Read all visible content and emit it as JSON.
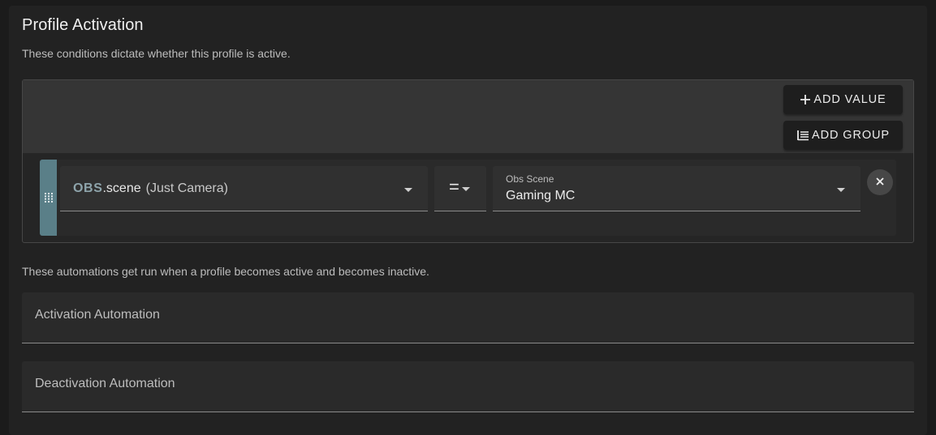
{
  "profile_activation": {
    "title": "Profile Activation",
    "description": "These conditions dictate whether this profile is active.",
    "buttons": {
      "add_value": "ADD VALUE",
      "add_group": "ADD GROUP"
    },
    "condition": {
      "variable_prefix": "OBS",
      "variable_name": ".scene",
      "variable_detail": "(Just Camera)",
      "operator": "=",
      "value_label": "Obs Scene",
      "value": "Gaming MC"
    }
  },
  "automations": {
    "description": "These automations get run when a profile becomes active and becomes inactive.",
    "activation_label": "Activation Automation",
    "deactivation_label": "Deactivation Automation"
  },
  "icons": {
    "add_value": "plus-icon",
    "add_group": "add-group-icon",
    "drag": "drag-handle-icon",
    "dropdown": "caret-down-icon",
    "remove": "close-icon"
  },
  "colors": {
    "accent": "#5a7f88",
    "variable_prefix": "#8ea4ab"
  }
}
